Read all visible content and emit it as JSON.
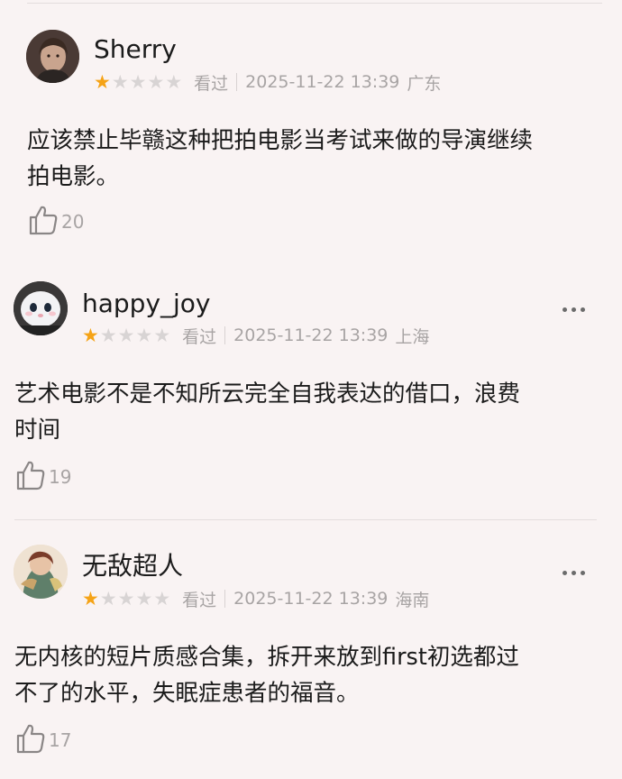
{
  "reviews": [
    {
      "username": "Sherry",
      "rating": 1,
      "status": "看过",
      "datetime": "2025-11-22 13:39",
      "location": "广东",
      "content_lines": [
        "应该禁止毕赣这种把拍电影当考试来做的导演继续",
        "拍电影。"
      ],
      "likes": "20"
    },
    {
      "username": "happy_joy",
      "rating": 1,
      "status": "看过",
      "datetime": "2025-11-22 13:39",
      "location": "上海",
      "content_lines": [
        "艺术电影不是不知所云完全自我表达的借口，浪费",
        "时间"
      ],
      "likes": "19"
    },
    {
      "username": "无敌超人",
      "rating": 1,
      "status": "看过",
      "datetime": "2025-11-22 13:39",
      "location": "海南",
      "content_lines": [
        "无内核的短片质感合集，拆开来放到first初选都过",
        "不了的水平，失眠症患者的福音。"
      ],
      "likes": "17"
    }
  ],
  "colors": {
    "background": "#f9f3f3",
    "star_active": "#f5a316",
    "star_inactive": "#d8d4d4",
    "meta_text": "#a8a4a4"
  },
  "icons": {
    "like": "thumbs-up-icon",
    "more": "more-icon",
    "star": "star-icon"
  }
}
